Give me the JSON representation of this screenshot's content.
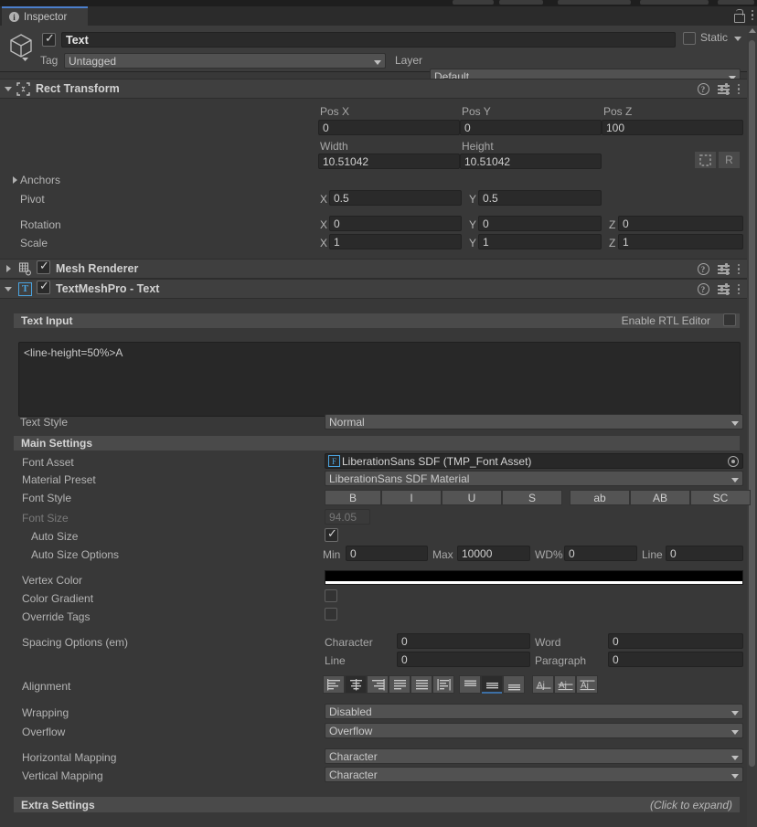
{
  "window": {
    "tab_label": "Inspector",
    "tab_icon": "info-icon",
    "lock_icon": "lock-open-icon",
    "menu_icon": "kebab-menu-icon"
  },
  "object_header": {
    "icon": "gameobject-cube-icon",
    "enabled": true,
    "name": "Text",
    "static_label": "Static",
    "static_checked": false,
    "tag_label": "Tag",
    "tag_value": "Untagged",
    "layer_label": "Layer",
    "layer_value": "Default"
  },
  "rect_transform": {
    "title": "Rect Transform",
    "expanded": true,
    "pos_x_label": "Pos X",
    "pos_x": "0",
    "pos_y_label": "Pos Y",
    "pos_y": "0",
    "pos_z_label": "Pos Z",
    "pos_z": "100",
    "width_label": "Width",
    "width": "10.51042",
    "height_label": "Height",
    "height": "10.51042",
    "anchors_label": "Anchors",
    "pivot_label": "Pivot",
    "pivot_x": "0.5",
    "pivot_y": "0.5",
    "rotation_label": "Rotation",
    "rotation_x": "0",
    "rotation_y": "0",
    "rotation_z": "0",
    "scale_label": "Scale",
    "scale_x": "1",
    "scale_y": "1",
    "scale_z": "1",
    "axis_x": "X",
    "axis_y": "Y",
    "axis_z": "Z",
    "blueprint_button": "blueprint-mode-icon",
    "raw_button": "R"
  },
  "mesh_renderer": {
    "title": "Mesh Renderer",
    "enabled": true,
    "expanded": false
  },
  "tmp_text": {
    "title": "TextMeshPro - Text",
    "enabled": true,
    "expanded": true,
    "text_input_label": "Text Input",
    "rtl_label": "Enable RTL Editor",
    "rtl_checked": false,
    "text_value": "<line-height=50%>A",
    "text_style_label": "Text Style",
    "text_style_value": "Normal",
    "main_settings_label": "Main Settings",
    "font_asset_label": "Font Asset",
    "font_asset_value": "LiberationSans SDF (TMP_Font Asset)",
    "material_preset_label": "Material Preset",
    "material_preset_value": "LiberationSans SDF Material",
    "font_style_label": "Font Style",
    "font_style_buttons": [
      "B",
      "I",
      "U",
      "S",
      "ab",
      "AB",
      "SC"
    ],
    "font_size_label": "Font Size",
    "font_size_value": "94.05",
    "font_size_disabled": true,
    "auto_size_label": "Auto Size",
    "auto_size_checked": true,
    "auto_size_options_label": "Auto Size Options",
    "min_label": "Min",
    "min_value": "0",
    "max_label": "Max",
    "max_value": "10000",
    "wd_label": "WD%",
    "wd_value": "0",
    "line_label": "Line",
    "line_value": "0",
    "vertex_color_label": "Vertex Color",
    "vertex_color_value": "#000000",
    "vertex_color_alpha": "#FFFFFF",
    "color_gradient_label": "Color Gradient",
    "color_gradient_checked": false,
    "override_tags_label": "Override Tags",
    "override_tags_checked": false,
    "spacing_label": "Spacing Options (em)",
    "spacing_character_label": "Character",
    "spacing_character": "0",
    "spacing_word_label": "Word",
    "spacing_word": "0",
    "spacing_line_label": "Line",
    "spacing_line": "0",
    "spacing_paragraph_label": "Paragraph",
    "spacing_paragraph": "0",
    "alignment_label": "Alignment",
    "horizontal_alignment_selected": 1,
    "vertical_alignment_selected": 1,
    "horizontal_alignment_icons": [
      "align-left-icon",
      "align-center-icon",
      "align-right-icon",
      "align-justified-icon",
      "align-flush-icon",
      "align-geometry-center-icon"
    ],
    "vertical_alignment_icons": [
      "align-top-icon",
      "align-middle-icon",
      "align-bottom-icon",
      "align-baseline-icon",
      "align-midline-icon",
      "align-capline-icon"
    ],
    "wrapping_label": "Wrapping",
    "wrapping_value": "Disabled",
    "overflow_label": "Overflow",
    "overflow_value": "Overflow",
    "horizontal_mapping_label": "Horizontal Mapping",
    "horizontal_mapping_value": "Character",
    "vertical_mapping_label": "Vertical Mapping",
    "vertical_mapping_value": "Character",
    "extra_settings_label": "Extra Settings",
    "extra_settings_hint": "(Click to expand)"
  },
  "icons": {
    "help": "help-icon",
    "preset": "preset-icon",
    "kebab": "kebab-menu-icon"
  }
}
